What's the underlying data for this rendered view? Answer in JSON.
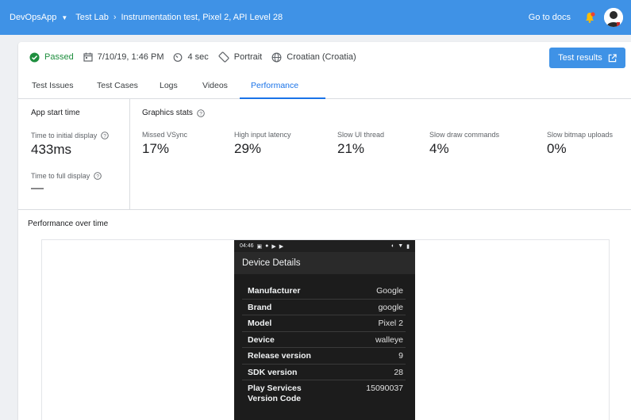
{
  "topbar": {
    "app": "DevOpsApp",
    "crumbs": [
      "Test Lab",
      "Instrumentation test, Pixel 2, API Level 28"
    ],
    "docs_link": "Go to docs"
  },
  "status": {
    "result": "Passed",
    "date": "7/10/19, 1:46 PM",
    "duration": "4 sec",
    "orientation": "Portrait",
    "locale": "Croatian (Croatia)",
    "results_button": "Test results"
  },
  "tabs": [
    {
      "label": "Test Issues",
      "active": false
    },
    {
      "label": "Test Cases",
      "active": false
    },
    {
      "label": "Logs",
      "active": false
    },
    {
      "label": "Videos",
      "active": false
    },
    {
      "label": "Performance",
      "active": true
    }
  ],
  "app_start": {
    "title": "App start time",
    "initial_label": "Time to initial display",
    "initial_value": "433ms",
    "full_label": "Time to full display",
    "full_value": "—"
  },
  "graphics": {
    "title": "Graphics stats",
    "metrics": [
      {
        "label": "Missed VSync",
        "value": "17%"
      },
      {
        "label": "High input latency",
        "value": "29%"
      },
      {
        "label": "Slow UI thread",
        "value": "21%"
      },
      {
        "label": "Slow draw commands",
        "value": "4%"
      },
      {
        "label": "Slow bitmap uploads",
        "value": "0%"
      }
    ]
  },
  "performance": {
    "title": "Performance over time"
  },
  "device": {
    "time": "04:46",
    "title": "Device Details",
    "rows": [
      {
        "key": "Manufacturer",
        "value": "Google"
      },
      {
        "key": "Brand",
        "value": "google"
      },
      {
        "key": "Model",
        "value": "Pixel 2"
      },
      {
        "key": "Device",
        "value": "walleye"
      },
      {
        "key": "Release version",
        "value": "9"
      },
      {
        "key": "SDK version",
        "value": "28"
      },
      {
        "key": "Play Services Version Code",
        "value": "15090037"
      }
    ]
  },
  "colors": {
    "brand": "#3f92e6",
    "passed": "#1e8e3e",
    "active_tab": "#1a73e8"
  }
}
